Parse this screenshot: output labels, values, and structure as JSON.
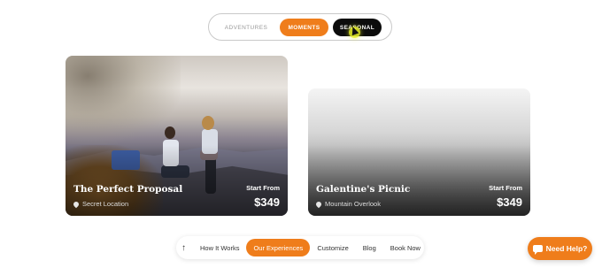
{
  "tabs": {
    "items": [
      {
        "label": "ADVENTURES",
        "active": false
      },
      {
        "label": "MOMENTS",
        "active": true
      },
      {
        "label": "SEASONAL",
        "hovered": true
      }
    ]
  },
  "cards": [
    {
      "title": "The Perfect Proposal",
      "location": "Secret Location",
      "start_label": "Start From",
      "price": "$349"
    },
    {
      "title": "Galentine's Picnic",
      "location": "Mountain Overlook",
      "start_label": "Start From",
      "price": "$349"
    }
  ],
  "bottom_nav": {
    "up_icon": "arrow-up-icon",
    "links": [
      "How It Works",
      "Our Experiences",
      "Customize",
      "Blog",
      "Book Now"
    ],
    "active_index": 1
  },
  "help": {
    "label": "Need Help?",
    "icon": "chat-icon"
  },
  "colors": {
    "accent": "#ef7d1b",
    "dark": "#0c0c0c"
  }
}
